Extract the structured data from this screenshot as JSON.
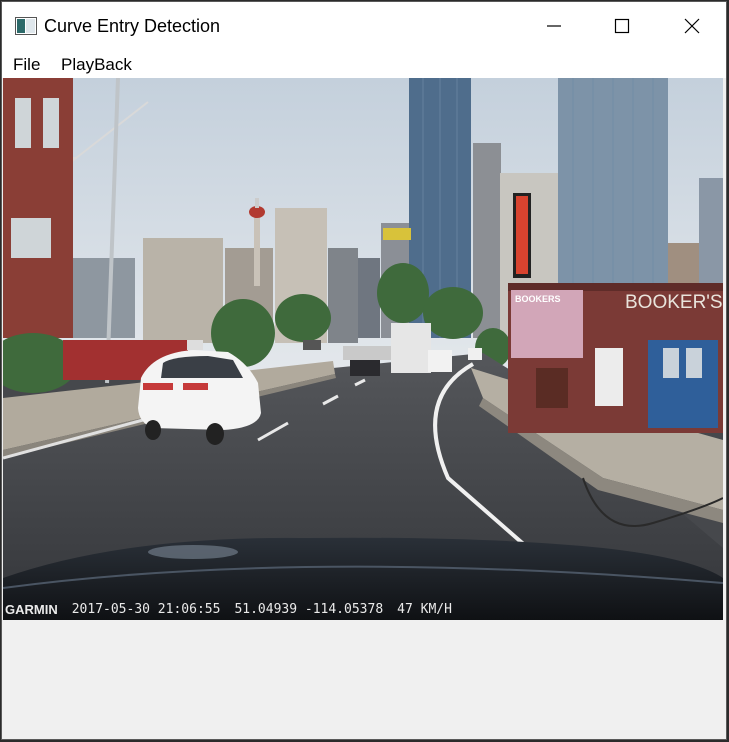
{
  "window": {
    "title": "Curve Entry Detection",
    "icon": "app-window-icon",
    "controls": [
      "minimize-icon",
      "maximize-icon",
      "close-icon"
    ]
  },
  "menu": {
    "items": [
      {
        "label": "File"
      },
      {
        "label": "PlayBack"
      }
    ]
  },
  "video": {
    "overlay": {
      "brand": "GARMIN",
      "datetime": "2017-05-30 21:06:55",
      "coordinates": "51.04939 -114.05378",
      "speed": "47 KM/H"
    },
    "signs": {
      "bookers_wall": "BOOKER'S",
      "bookers_vertical": "BOOKERS"
    }
  },
  "colors": {
    "titlebar": "#ffffff",
    "client_area": "#f0f0f0",
    "sky": "#cfd9e3",
    "road": "#3f4145",
    "brick": "#7d3a36"
  }
}
